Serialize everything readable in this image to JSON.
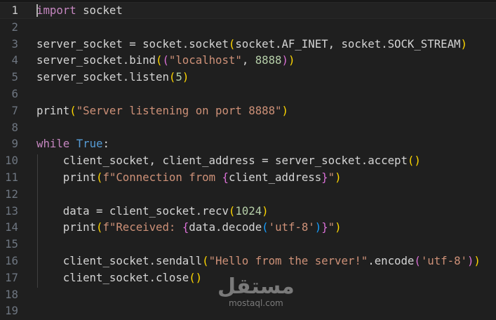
{
  "editor": {
    "current_line": 1,
    "lines": [
      {
        "n": "1",
        "t": [
          [
            "import",
            "kw"
          ],
          [
            " socket",
            ""
          ]
        ]
      },
      {
        "n": "2",
        "t": []
      },
      {
        "n": "3",
        "t": [
          [
            "server_socket = socket.socket",
            ""
          ],
          [
            "(",
            "b1"
          ],
          [
            "socket.AF_INET, socket.SOCK_STREAM",
            ""
          ],
          [
            ")",
            "b1"
          ]
        ]
      },
      {
        "n": "4",
        "t": [
          [
            "server_socket.bind",
            ""
          ],
          [
            "(",
            "b1"
          ],
          [
            "(",
            "b2"
          ],
          [
            "\"localhost\"",
            "str"
          ],
          [
            ", ",
            ""
          ],
          [
            "8888",
            "num"
          ],
          [
            ")",
            "b2"
          ],
          [
            ")",
            "b1"
          ]
        ]
      },
      {
        "n": "5",
        "t": [
          [
            "server_socket.listen",
            ""
          ],
          [
            "(",
            "b1"
          ],
          [
            "5",
            "num"
          ],
          [
            ")",
            "b1"
          ]
        ]
      },
      {
        "n": "6",
        "t": []
      },
      {
        "n": "7",
        "t": [
          [
            "print",
            ""
          ],
          [
            "(",
            "b1"
          ],
          [
            "\"Server listening on port 8888\"",
            "str"
          ],
          [
            ")",
            "b1"
          ]
        ]
      },
      {
        "n": "8",
        "t": []
      },
      {
        "n": "9",
        "t": [
          [
            "while",
            "kw"
          ],
          [
            " ",
            ""
          ],
          [
            "True",
            "const"
          ],
          [
            ":",
            ""
          ]
        ]
      },
      {
        "n": "10",
        "t": [
          [
            "    client_socket, client_address = server_socket.accept",
            ""
          ],
          [
            "()",
            "b1"
          ]
        ]
      },
      {
        "n": "11",
        "t": [
          [
            "    print",
            ""
          ],
          [
            "(",
            "b1"
          ],
          [
            "f\"Connection from ",
            "str"
          ],
          [
            "{",
            "b2"
          ],
          [
            "client_address",
            ""
          ],
          [
            "}",
            "b2"
          ],
          [
            "\"",
            "str"
          ],
          [
            ")",
            "b1"
          ]
        ]
      },
      {
        "n": "12",
        "t": []
      },
      {
        "n": "13",
        "t": [
          [
            "    data = client_socket.recv",
            ""
          ],
          [
            "(",
            "b1"
          ],
          [
            "1024",
            "num"
          ],
          [
            ")",
            "b1"
          ]
        ]
      },
      {
        "n": "14",
        "t": [
          [
            "    print",
            ""
          ],
          [
            "(",
            "b1"
          ],
          [
            "f\"Received: ",
            "str"
          ],
          [
            "{",
            "b2"
          ],
          [
            "data.decode",
            ""
          ],
          [
            "(",
            "b3"
          ],
          [
            "'utf-8'",
            "str"
          ],
          [
            ")",
            "b3"
          ],
          [
            "}",
            "b2"
          ],
          [
            "\"",
            "str"
          ],
          [
            ")",
            "b1"
          ]
        ]
      },
      {
        "n": "15",
        "t": []
      },
      {
        "n": "16",
        "t": [
          [
            "    client_socket.sendall",
            ""
          ],
          [
            "(",
            "b1"
          ],
          [
            "\"Hello from the server!\"",
            "str"
          ],
          [
            ".encode",
            ""
          ],
          [
            "(",
            "b2"
          ],
          [
            "'utf-8'",
            "str"
          ],
          [
            ")",
            "b2"
          ],
          [
            ")",
            "b1"
          ]
        ]
      },
      {
        "n": "17",
        "t": [
          [
            "    client_socket.close",
            ""
          ],
          [
            "()",
            "b1"
          ]
        ]
      },
      {
        "n": "18",
        "t": []
      },
      {
        "n": "19",
        "t": []
      }
    ]
  },
  "watermark": {
    "arabic": "مستقل",
    "latin": "mostaql.com"
  }
}
